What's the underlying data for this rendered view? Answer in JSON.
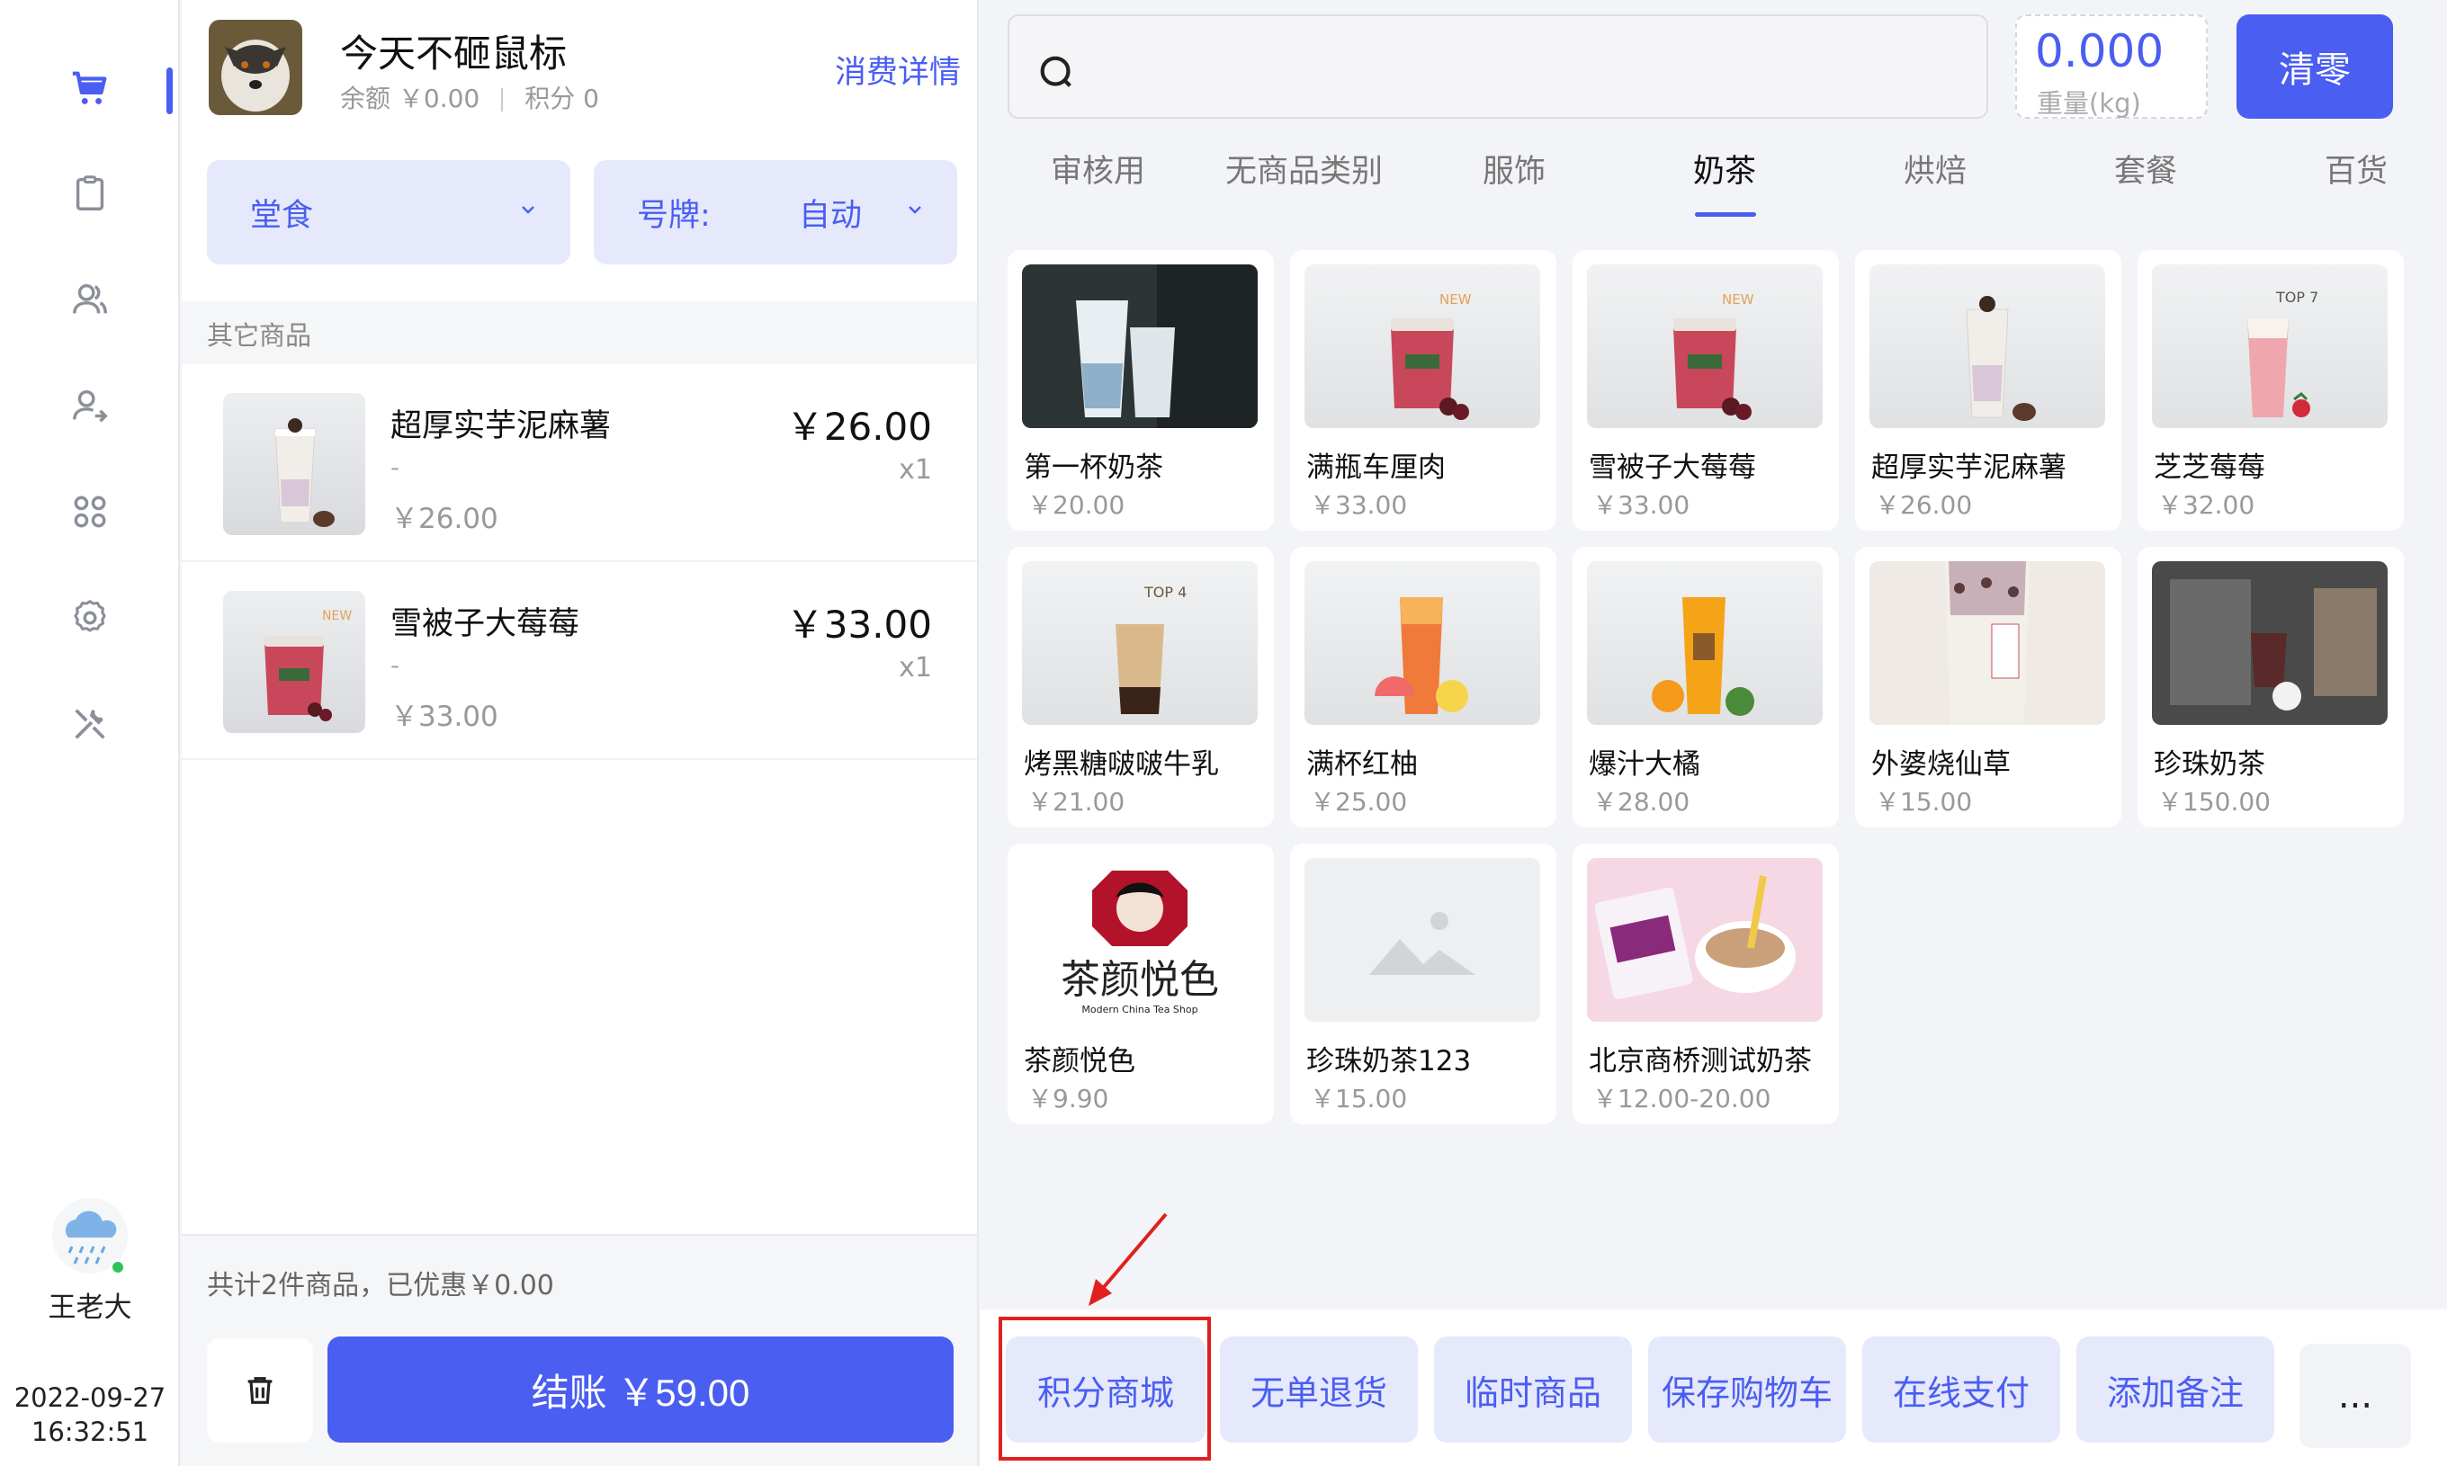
{
  "user": {
    "name": "王老大"
  },
  "clock": {
    "date": "2022-09-27",
    "time": "16:32:51"
  },
  "member": {
    "name": "今天不砸鼠标",
    "balance": "余额 ￥0.00",
    "points": "积分 0",
    "detail_link": "消费详情"
  },
  "dining": {
    "mode": "堂食",
    "tag_label": "号牌:",
    "tag_value": "自动"
  },
  "cart": {
    "group_title": "其它商品",
    "items": [
      {
        "name": "超厚实芋泥麻薯",
        "spec": "-",
        "unit_price": "￥26.00",
        "price": "￥26.00",
        "qty": "x1"
      },
      {
        "name": "雪被子大莓莓",
        "spec": "-",
        "unit_price": "￥33.00",
        "price": "￥33.00",
        "qty": "x1"
      }
    ],
    "summary": "共计2件商品，已优惠￥0.00",
    "checkout_label": "结账  ￥59.00"
  },
  "scale": {
    "value": "0.000",
    "label": "重量(kg)",
    "clear_label": "清零"
  },
  "tabs": [
    "审核用",
    "无商品类别",
    "服饰",
    "奶茶",
    "烘焙",
    "套餐",
    "百货"
  ],
  "active_tab": "奶茶",
  "products": [
    {
      "name": "第一杯奶茶",
      "price": "￥20.00"
    },
    {
      "name": "满瓶车厘肉",
      "price": "￥33.00"
    },
    {
      "name": "雪被子大莓莓",
      "price": "￥33.00"
    },
    {
      "name": "超厚实芋泥麻薯",
      "price": "￥26.00"
    },
    {
      "name": "芝芝莓莓",
      "price": "￥32.00"
    },
    {
      "name": "烤黑糖啵啵牛乳",
      "price": "￥21.00"
    },
    {
      "name": "满杯红柚",
      "price": "￥25.00"
    },
    {
      "name": "爆汁大橘",
      "price": "￥28.00"
    },
    {
      "name": "外婆烧仙草",
      "price": "￥15.00"
    },
    {
      "name": "珍珠奶茶",
      "price": "￥150.00"
    },
    {
      "name": "茶颜悦色",
      "price": "￥9.90"
    },
    {
      "name": "珍珠奶茶123",
      "price": "￥15.00"
    },
    {
      "name": "北京商桥测试奶茶",
      "price": "￥12.00-20.00"
    }
  ],
  "product_badges": {
    "new": "NEW",
    "top4": "TOP 4",
    "top7": "TOP 7",
    "brand": "茶颜悦色",
    "brand_sub": "Modern China Tea Shop"
  },
  "actions": [
    "积分商城",
    "无单退货",
    "临时商品",
    "保存购物车",
    "在线支付",
    "添加备注"
  ],
  "more_label": "...",
  "colors": {
    "accent": "#4a5ef2",
    "accent_light": "#e6e9fb",
    "highlight": "#e02020"
  }
}
